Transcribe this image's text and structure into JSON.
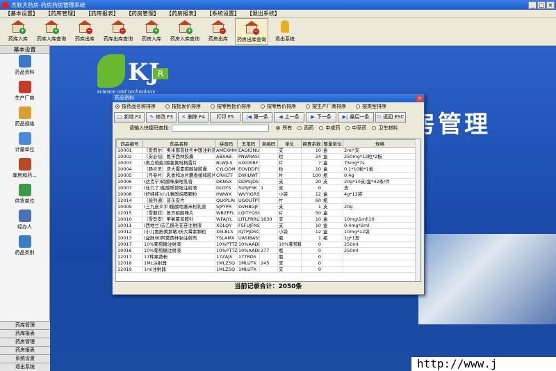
{
  "window": {
    "title": "杰软大药房-药房药房管理系统"
  },
  "menu": [
    "【基本设置】",
    "【药库管理】",
    "【药库报表】",
    "【药房管理】",
    "【药房报表】",
    "【系统设置】",
    "【退出系统】"
  ],
  "toolbar": [
    {
      "label": "药库入库",
      "badge": "+"
    },
    {
      "label": "药库入库查询",
      "badge": "+"
    },
    {
      "label": "药库出库",
      "badge": "−"
    },
    {
      "label": "药库出库查询",
      "badge": "−"
    },
    {
      "label": "药房入库",
      "badge": "+"
    },
    {
      "label": "药房入库查询",
      "badge": "+"
    },
    {
      "label": "药房出库",
      "badge": "−"
    },
    {
      "label": "药房出库查询",
      "badge": "−"
    },
    {
      "label": "退出系统",
      "badge": ""
    }
  ],
  "sidebar": {
    "header": "基本设置",
    "items": [
      {
        "label": "药品资料",
        "color": "#3a78c8"
      },
      {
        "label": "生产厂商",
        "color": "#c83a2a"
      },
      {
        "label": "药品规格",
        "color": "#d8a030"
      },
      {
        "label": "计量单位",
        "color": "#4a8ad8"
      },
      {
        "label": "库房和药...",
        "color": "#b84828"
      },
      {
        "label": "供货单位",
        "color": "#3a9a4a"
      },
      {
        "label": "经办人",
        "color": "#4a70b8"
      },
      {
        "label": "药品类别",
        "color": "#3a80c0"
      }
    ],
    "footer": [
      "药库管理",
      "药库报表",
      "药房管理",
      "药房报表",
      "系统设置",
      "退出系统"
    ]
  },
  "background": {
    "logo_letters": "KJ",
    "logo_r": "R",
    "logo_en": "science and technology",
    "big_title": "房管理",
    "website": "http://www.j"
  },
  "modal": {
    "title": "药品资料",
    "close": "×",
    "sort_options": [
      {
        "label": "按药品名称排序",
        "checked": true
      },
      {
        "label": "按批发价排序",
        "checked": false
      },
      {
        "label": "按零售批价排序",
        "checked": false
      },
      {
        "label": "按零售价排序",
        "checked": false
      },
      {
        "label": "按生产厂商排序",
        "checked": false
      },
      {
        "label": "按类型排序",
        "checked": false
      }
    ],
    "buttons": [
      {
        "icon": "□",
        "label": "新增 F2"
      },
      {
        "icon": "✎",
        "label": "修改 F3"
      },
      {
        "icon": "✕",
        "label": "删除 F4"
      },
      {
        "icon": "",
        "label": "打印 F5"
      },
      {
        "icon": "|◀",
        "label": "第一条"
      },
      {
        "icon": "◀",
        "label": "上一条"
      },
      {
        "icon": "▶",
        "label": "下一条"
      },
      {
        "icon": "▶|",
        "label": "最后一条"
      },
      {
        "icon": "⎋",
        "label": "返回 ESC"
      }
    ],
    "search_label": "请输入快捷码查找:",
    "search_value": "",
    "filters": [
      {
        "label": "所有",
        "checked": true
      },
      {
        "label": "西药",
        "checked": false
      },
      {
        "label": "中成药",
        "checked": false
      },
      {
        "label": "中草药",
        "checked": false
      },
      {
        "label": "卫生材料",
        "checked": false
      }
    ],
    "columns": [
      "药品编号",
      "药品名称",
      "拼音码",
      "五笔码",
      "自编码",
      "单位",
      "换算系数",
      "整量单位",
      "规格"
    ],
    "rows": [
      [
        "10001",
        "（爱而尔）奥米那普肽冬中国注射液",
        "AMEXMM",
        "EAQIONU",
        "",
        "支",
        "10",
        "盒",
        "2ml*支"
      ],
      [
        "10002",
        "（安必仙）氨苄西林胶囊",
        "ABXAB",
        "PNWRASS",
        "",
        "粒",
        "24",
        "盒",
        "250mg*12粒*2板"
      ],
      [
        "10003",
        "(奥立维能)酸氯氟吡格雷片",
        "BLWJLS",
        "IUXDSRF",
        "",
        "片",
        "7",
        "盒",
        "75mg*7s"
      ],
      [
        "10004",
        "（肠炎灵）庆大霉素碳酸铋胶囊",
        "CYLQDM",
        "EOVDDFG",
        "",
        "粒",
        "10",
        "盒",
        "0.1*10粒*1板"
      ],
      [
        "10005",
        "（丹参片）乳香和冰片麝香缓释胶片",
        "CRHLTF",
        "DWIUWT",
        "",
        "片",
        "100",
        "瓶",
        "0.4g"
      ],
      [
        "10006",
        "(达克宁)硝酸咪康唑乳膏",
        "DKNSX",
        "DDPSJDS",
        "",
        "支",
        "20",
        "支",
        "20g*10支/盒*42条/件"
      ],
      [
        "10007",
        "(杜力丁)盐酸哌替啶注射液",
        "DLDYS",
        "SUSJFSK",
        "1",
        "支",
        "0",
        "",
        "支"
      ],
      [
        "10008",
        "(好娃娃)小儿氨酚烷胺颗粒",
        "HWWX",
        "WVYIGRS",
        "",
        "小袋",
        "12",
        "盒",
        "4g*12袋"
      ],
      [
        "12014",
        "（能列通）普乐安片",
        "QLKPLAI",
        "UGOUTPT",
        "",
        "片",
        "60",
        "瓶",
        ""
      ],
      [
        "10009",
        "(三九皮炎平)醋酸地塞米松乳膏",
        "SJPYPR",
        "DVHBGJF",
        "",
        "支",
        "1",
        "支",
        "20g"
      ],
      [
        "12015",
        "（雪丽欣）复方硝酸咪片",
        "WBZFFL",
        "LQITYQSC",
        "",
        "片",
        "50",
        "盒",
        ""
      ],
      [
        "10010",
        "（雪登安）甲氧氯普胺针",
        "WFAJYL",
        "LITLPRRUI",
        "1630",
        "支",
        "10",
        "盒",
        "10mg\\1ml\\10"
      ],
      [
        "10011",
        "(西地兰)去乙酰毛花苷注射液",
        "XDLQY",
        "FSFUJFNSE",
        "",
        "支",
        "10",
        "盒",
        "0.4mg*2ml"
      ],
      [
        "10012",
        "(小儿氨酚黄那敏)庆大霉素颗粒",
        "XELBLS",
        "IQTPJDSC",
        "",
        "小袋",
        "12",
        "盒",
        "10mg*12袋"
      ],
      [
        "10013",
        "(益肤林)阿莫西林钠注射剂",
        "YSLAMX",
        "UASIBASS",
        "",
        "瓶",
        "1",
        "瓶",
        "1g*1支"
      ],
      [
        "10017",
        "10%葡萄糖注射液",
        "10%PTTZ",
        "10%AADIT",
        "",
        "10%葡萄糖",
        "0",
        "",
        "250ml"
      ],
      [
        "10016",
        "10%葡萄糖注射液",
        "10%PTTZ",
        "10%AADIT",
        "277",
        "瓶",
        "0",
        "",
        "250ml"
      ],
      [
        "12017",
        "17种果蔬粉",
        "17ZAJS",
        "17TRDS",
        "",
        "瓶",
        "0",
        "",
        ""
      ],
      [
        "12018",
        "1ML注射器",
        "1MLZSQ",
        "1MLUTK",
        "245",
        "支",
        "0",
        "",
        ""
      ],
      [
        "12019",
        "1ml注射器",
        "1MLZSQ",
        "1MLUTK",
        "",
        "支",
        "0",
        "",
        ""
      ]
    ],
    "status": "当前记录合计：2050条"
  }
}
